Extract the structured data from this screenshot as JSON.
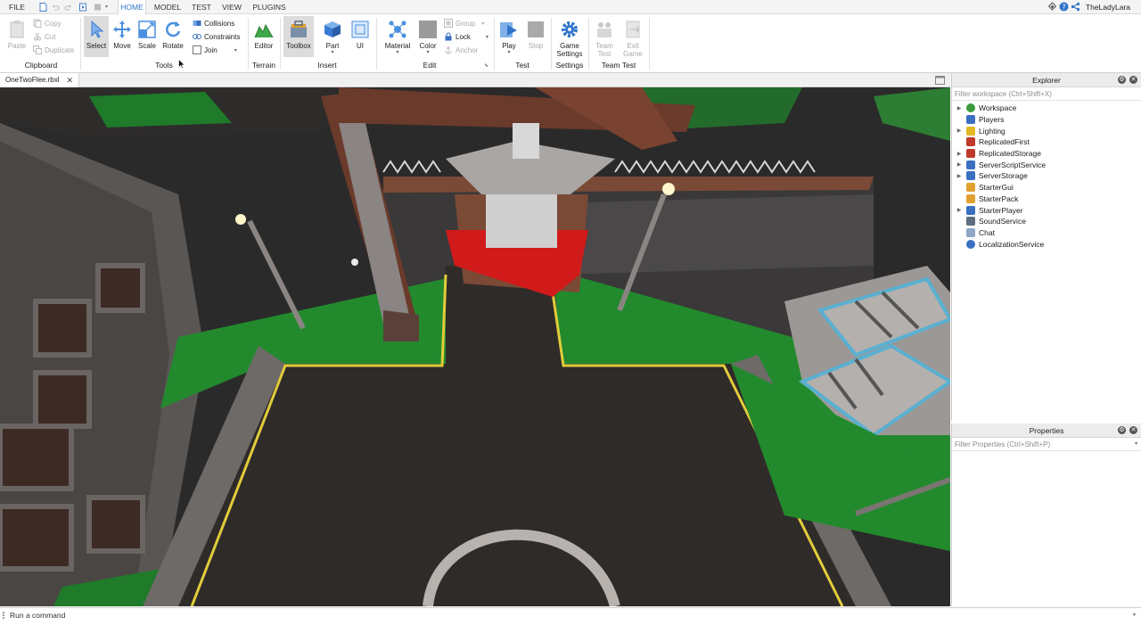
{
  "menu": {
    "file": "FILE",
    "tabs": [
      "HOME",
      "MODEL",
      "TEST",
      "VIEW",
      "PLUGINS"
    ],
    "active_tab": "HOME",
    "user": "TheLadyLara"
  },
  "ribbon": {
    "clipboard": {
      "paste": "Paste",
      "copy": "Copy",
      "cut": "Cut",
      "duplicate": "Duplicate",
      "group": "Clipboard"
    },
    "tools": {
      "select": "Select",
      "move": "Move",
      "scale": "Scale",
      "rotate": "Rotate",
      "collisions": "Collisions",
      "constraints": "Constraints",
      "join": "Join",
      "group": "Tools"
    },
    "terrain": {
      "editor": "Editor",
      "group": "Terrain"
    },
    "insert": {
      "toolbox": "Toolbox",
      "part": "Part",
      "ui": "UI",
      "group": "Insert"
    },
    "edit": {
      "material": "Material",
      "color": "Color",
      "group_btn": "Group",
      "lock": "Lock",
      "anchor": "Anchor",
      "group": "Edit"
    },
    "test": {
      "play": "Play",
      "stop": "Stop",
      "group": "Test"
    },
    "settings": {
      "game_settings_1": "Game",
      "game_settings_2": "Settings",
      "group": "Settings"
    },
    "team_test": {
      "team_test_1": "Team",
      "team_test_2": "Test",
      "exit_game_1": "Exit",
      "exit_game_2": "Game",
      "group": "Team Test"
    }
  },
  "document": {
    "tab": "OneTwoFlee.rbxl",
    "close": "✕"
  },
  "explorer": {
    "title": "Explorer",
    "filter_placeholder": "Filter workspace (Ctrl+Shift+X)",
    "items": [
      {
        "label": "Workspace",
        "expandable": true,
        "color": "#3b9a3b"
      },
      {
        "label": "Players",
        "expandable": false,
        "color": "#3a6fc2"
      },
      {
        "label": "Lighting",
        "expandable": true,
        "color": "#e2b825"
      },
      {
        "label": "ReplicatedFirst",
        "expandable": false,
        "color": "#c0392b"
      },
      {
        "label": "ReplicatedStorage",
        "expandable": true,
        "color": "#c0392b"
      },
      {
        "label": "ServerScriptService",
        "expandable": true,
        "color": "#3a6fc2"
      },
      {
        "label": "ServerStorage",
        "expandable": true,
        "color": "#3a6fc2"
      },
      {
        "label": "StarterGui",
        "expandable": false,
        "color": "#e0a030"
      },
      {
        "label": "StarterPack",
        "expandable": false,
        "color": "#e0a030"
      },
      {
        "label": "StarterPlayer",
        "expandable": true,
        "color": "#3a6fc2"
      },
      {
        "label": "SoundService",
        "expandable": false,
        "color": "#5d6d7e"
      },
      {
        "label": "Chat",
        "expandable": false,
        "color": "#8fa8c8"
      },
      {
        "label": "LocalizationService",
        "expandable": false,
        "color": "#3a6fc2"
      }
    ]
  },
  "properties": {
    "title": "Properties",
    "filter_placeholder": "Filter Properties (Ctrl+Shift+P)"
  },
  "command_bar": {
    "placeholder": "Run a command"
  }
}
